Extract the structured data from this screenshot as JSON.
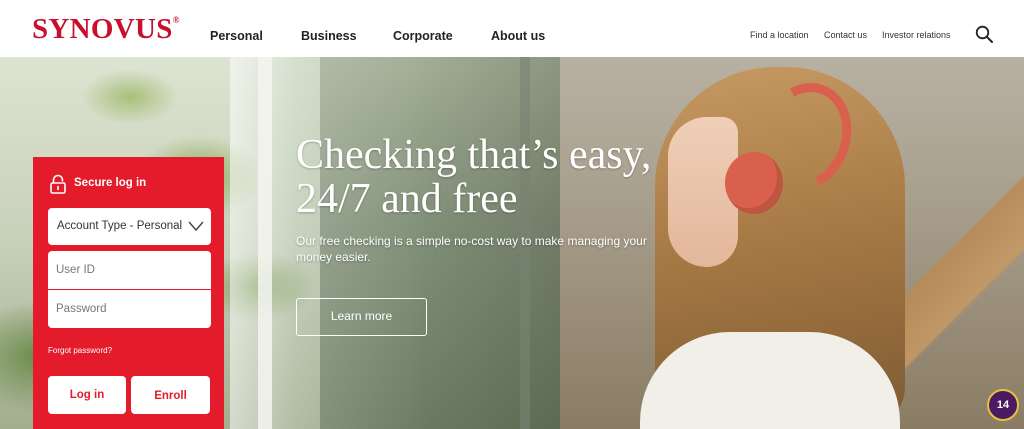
{
  "header": {
    "logo_text": "SYNOVUS",
    "logo_mark": "®",
    "main_nav": [
      "Personal",
      "Business",
      "Corporate",
      "About us"
    ],
    "utility_nav": [
      "Find a location",
      "Contact us",
      "Investor relations"
    ],
    "search_icon": "search-icon"
  },
  "login": {
    "title": "Secure log in",
    "lock_icon": "lock-icon",
    "account_type": "Account Type - Personal",
    "user_id_placeholder": "User ID",
    "password_placeholder": "Password",
    "forgot_password": "Forgot password?",
    "login_button": "Log in",
    "enroll_button": "Enroll"
  },
  "hero": {
    "headline_line1": "Checking that’s easy,",
    "headline_line2": "24/7 and free",
    "subtext": "Our free checking is a simple no-cost way to make managing your money easier.",
    "cta": "Learn more"
  },
  "badge": {
    "count": "14"
  },
  "colors": {
    "brand_red": "#e41b2b",
    "logo_red": "#c8102e",
    "badge_purple": "#4b1a63",
    "badge_ring": "#e8c23a"
  }
}
